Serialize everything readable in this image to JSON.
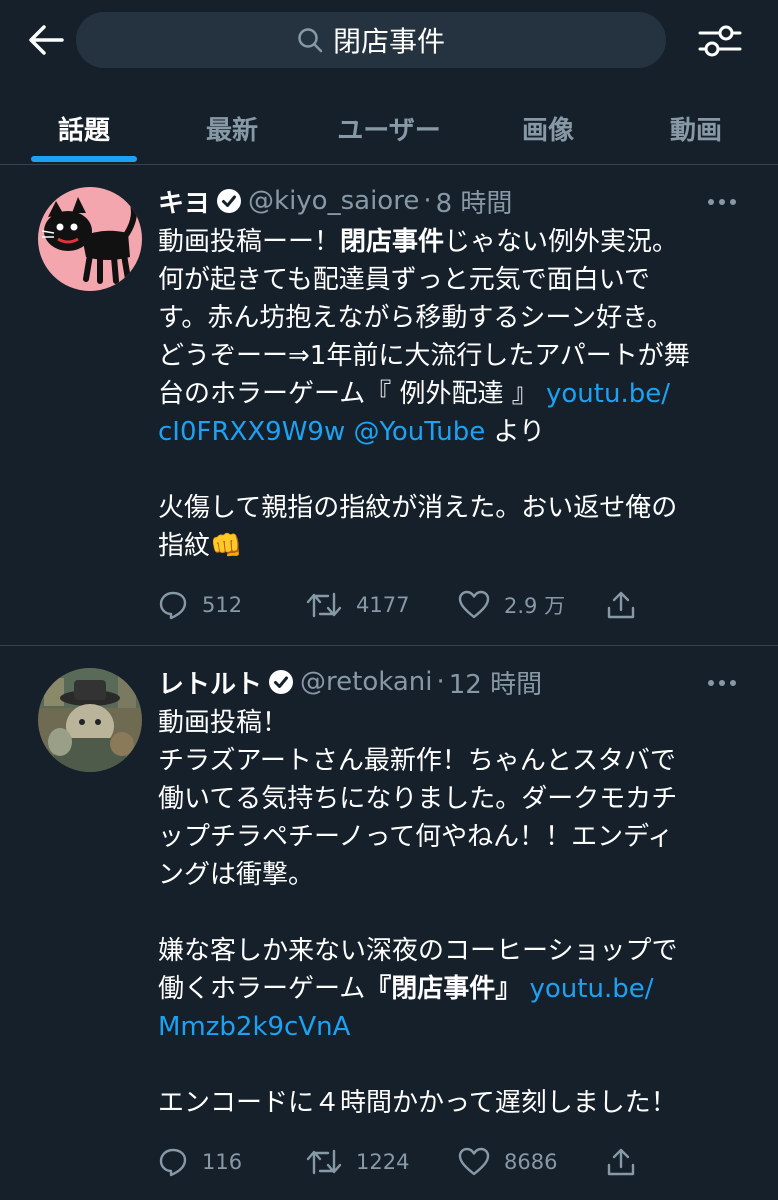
{
  "search": {
    "query": "閉店事件"
  },
  "tabs": [
    {
      "label": "話題"
    },
    {
      "label": "最新"
    },
    {
      "label": "ユーザー"
    },
    {
      "label": "画像"
    },
    {
      "label": "動画"
    }
  ],
  "colors": {
    "background": "#15202b",
    "accent": "#1da1f2",
    "muted": "#8899a6",
    "divider": "#38444d"
  },
  "tweets": [
    {
      "name": "キヨ",
      "handle": "@kiyo_saiore",
      "sep": "·",
      "time": "8 時間",
      "lines": {
        "l1a": "動画投稿ーー！",
        "l1b": "閉店事件",
        "l1c": "じゃない例外実況。",
        "l2": "何が起きても配達員ずっと元気で面白いで",
        "l3": "す。赤ん坊抱えながら移動するシーン好き。",
        "l4": "どうぞーー⇒1年前に大流行したアパートが舞",
        "l5a": "台のホラーゲーム『 例外配達 』 ",
        "l5b": "youtu.be/",
        "l6a": "cI0FRXX9W9w @YouTube",
        "l6b": " より",
        "l7": "火傷して親指の指紋が消えた。おい返せ俺の",
        "l8": "指紋👊"
      },
      "stats": {
        "replies": "512",
        "retweets": "4177",
        "likes": "2.9 万"
      }
    },
    {
      "name": "レトルト",
      "handle": "@retokani",
      "sep": "·",
      "time": "12 時間",
      "lines": {
        "l1": "動画投稿！",
        "l2": "チラズアートさん最新作！ちゃんとスタバで",
        "l3": "働いてる気持ちになりました。ダークモカチ",
        "l4": "ップチラペチーノって何やねん！！エンディ",
        "l5": "ングは衝撃。",
        "l6": "嫌な客しか来ない深夜のコーヒーショップで",
        "l7a": "働くホラーゲーム",
        "l7b": "『閉店事件』",
        "l7c": " ",
        "l7d": "youtu.be/",
        "l8": "Mmzb2k9cVnA",
        "l9": "エンコードに４時間かかって遅刻しました！"
      },
      "stats": {
        "replies": "116",
        "retweets": "1224",
        "likes": "8686"
      }
    }
  ]
}
